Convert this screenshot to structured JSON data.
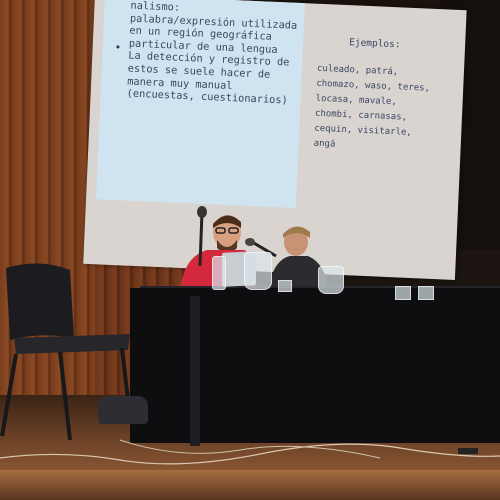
{
  "slide": {
    "left_lines": "nalismo:\npalabra/expresión utilizada\nen un región geográfica\nparticular de una lengua\nLa detección y registro de\nestos se suele hacer de\nmanera muy manual\n(encuestas, cuestionarios)",
    "bullet": "•",
    "right_heading": "Ejemplos:",
    "right_lines": "culeado, patrá,\nchomazo, waso, teres,\nlocasa, mavale,\nchombi, carnasas,\ncequin, visitarle,\nangá"
  },
  "colors": {
    "slide_blue_panel": "#cfe4f0",
    "slide_text": "#3b4664",
    "wood_wall": "#7a3e1e",
    "tablecloth": "#0e0e10",
    "speaker_shirt": "#d4283c"
  },
  "icons": [
    "microphone-icon",
    "laptop-icon",
    "water-pitcher-icon",
    "glass-icon",
    "chair-icon"
  ]
}
